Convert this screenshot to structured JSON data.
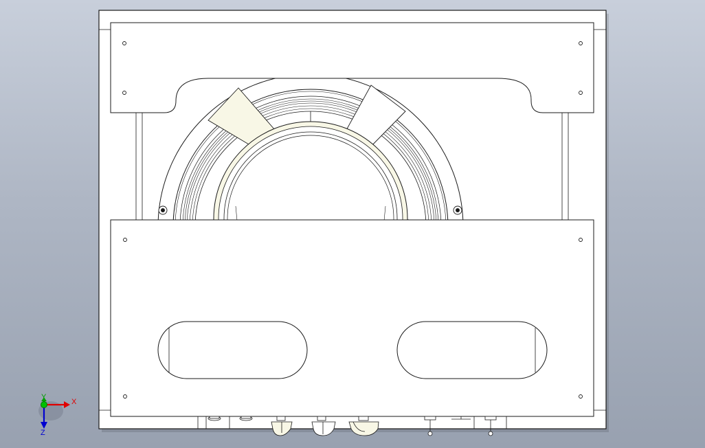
{
  "colors": {
    "background_top": "#c8cfdb",
    "background_bottom": "#98a1b0",
    "part_fill": "#ffffff",
    "edge": "#1a1a1a",
    "highlight_fill": "#f8f7e6",
    "axis_x": "#e00000",
    "axis_y": "#00a000",
    "axis_z": "#0000d0",
    "origin": "#00c000"
  },
  "triad": {
    "x_label": "X",
    "y_label": "Y",
    "z_label": "Z"
  }
}
